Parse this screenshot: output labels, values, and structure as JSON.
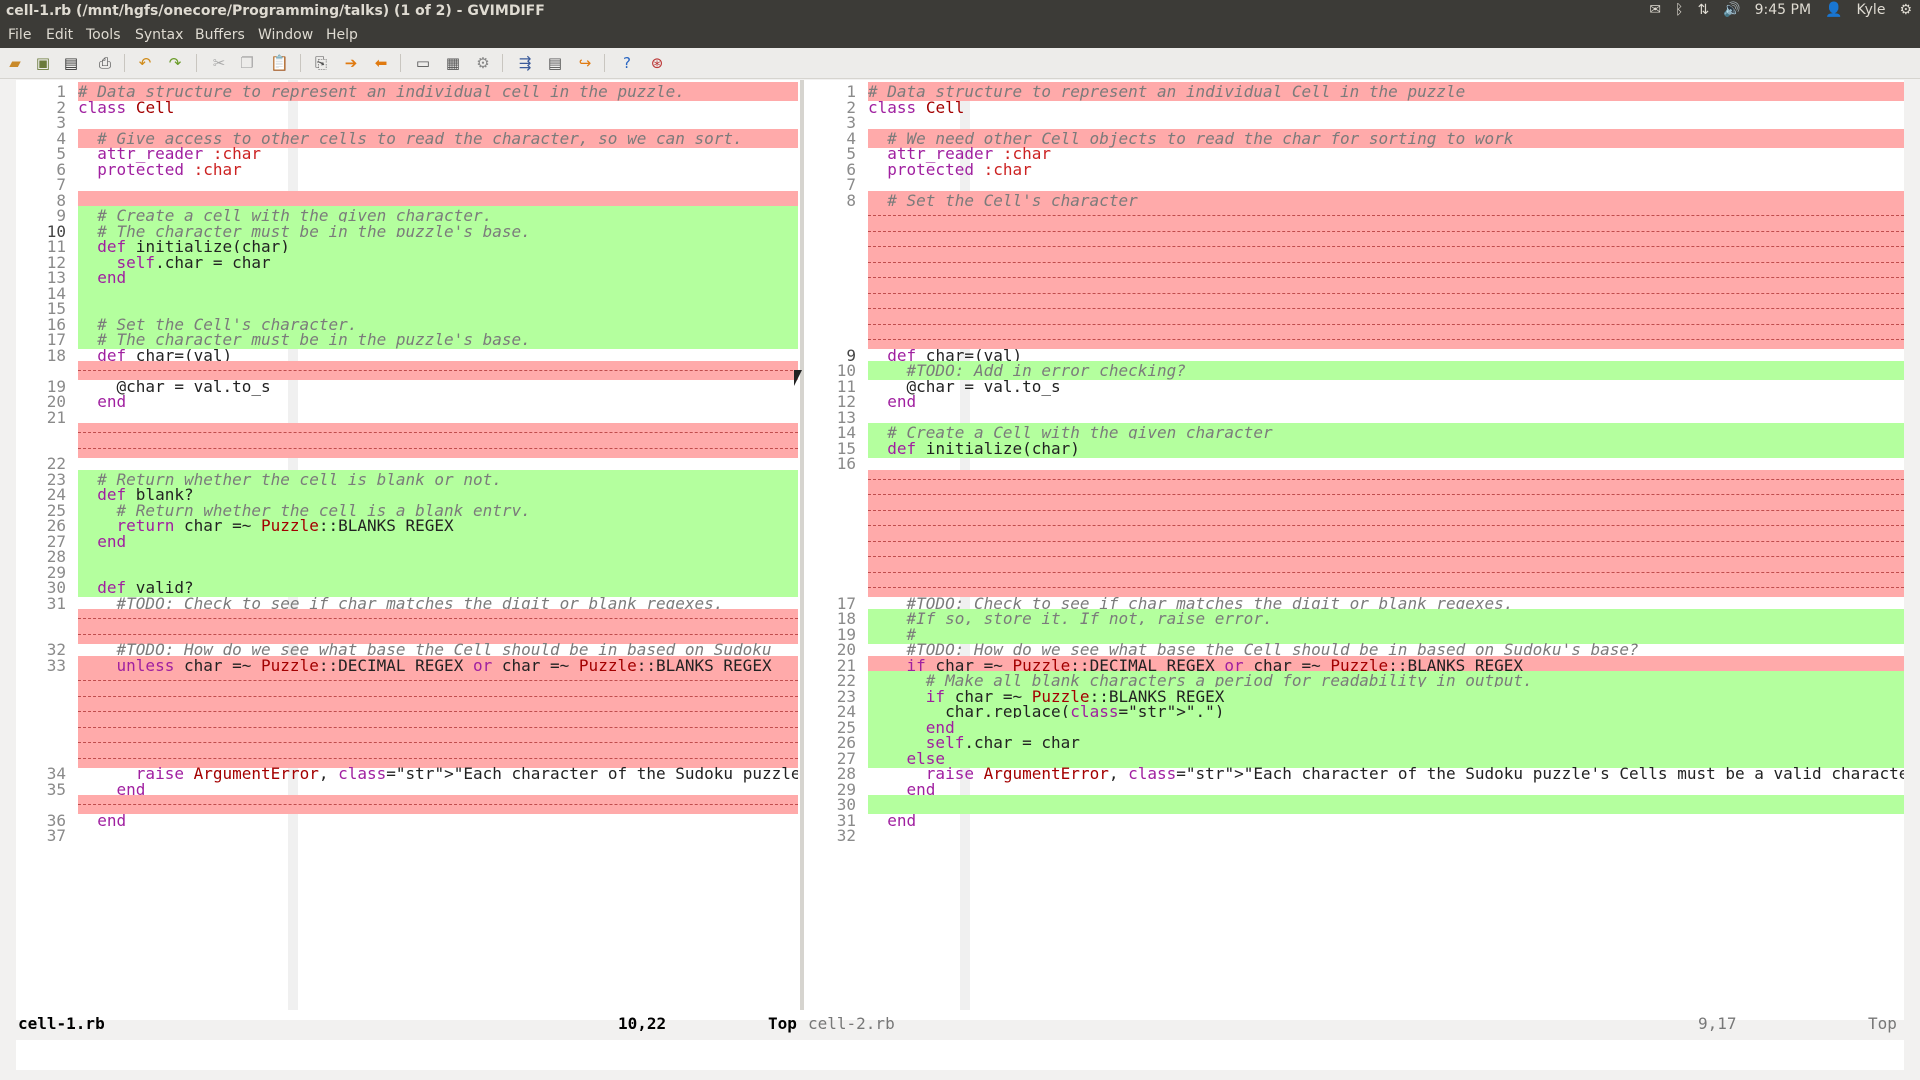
{
  "window": {
    "title": "cell-1.rb (/mnt/hgfs/onecore/Programming/talks) (1 of 2) - GVIMDIFF"
  },
  "tray": {
    "time": "9:45 PM",
    "user": "Kyle"
  },
  "menu": [
    "File",
    "Edit",
    "Tools",
    "Syntax",
    "Buffers",
    "Window",
    "Help"
  ],
  "toolbar_icons": [
    "open-icon",
    "save-icon",
    "save-all-icon",
    "print-icon",
    "undo-icon",
    "redo-icon",
    "cut-icon",
    "copy-icon",
    "paste-icon",
    "find-replace-icon",
    "find-next-icon",
    "find-prev-icon",
    "load-session-icon",
    "save-session-icon",
    "run-script-icon",
    "make-icon",
    "shell-icon",
    "ctags-icon",
    "help-icon",
    "find-help-icon"
  ],
  "colors": {
    "added": "#b4ff9e",
    "changed": "#ffaaaa",
    "deleted_filler": "#ffaaaa"
  },
  "left_pane": {
    "filename": "cell-1.rb",
    "cursor_position": "10,22",
    "scroll": "Top",
    "lines": [
      {
        "n": "1",
        "bg": "change",
        "text": "# Data structure to represent an individual cell in the puzzle."
      },
      {
        "n": "2",
        "bg": "",
        "text": "class Cell"
      },
      {
        "n": "3",
        "bg": "",
        "text": ""
      },
      {
        "n": "4",
        "bg": "change",
        "text": "  # Give access to other cells to read the character, so we can sort."
      },
      {
        "n": "5",
        "bg": "",
        "text": "  attr_reader :char"
      },
      {
        "n": "6",
        "bg": "",
        "text": "  protected :char"
      },
      {
        "n": "7",
        "bg": "",
        "text": ""
      },
      {
        "n": "8",
        "bg": "change",
        "text": ""
      },
      {
        "n": "9",
        "bg": "add",
        "text": "  # Create a cell with the given character."
      },
      {
        "n": "10",
        "bg": "add",
        "text": "  # The character must be in the puzzle's base.",
        "cur": true
      },
      {
        "n": "11",
        "bg": "add",
        "text": "  def initialize(char)"
      },
      {
        "n": "12",
        "bg": "add",
        "text": "    self.char = char"
      },
      {
        "n": "13",
        "bg": "add",
        "text": "  end"
      },
      {
        "n": "14",
        "bg": "add",
        "text": ""
      },
      {
        "n": "15",
        "bg": "add",
        "text": ""
      },
      {
        "n": "16",
        "bg": "add",
        "text": "  # Set the Cell's character."
      },
      {
        "n": "17",
        "bg": "add",
        "text": "  # The character must be in the puzzle's base."
      },
      {
        "n": "18",
        "bg": "",
        "text": "  def char=(val)"
      },
      {
        "n": "",
        "bg": "filler",
        "text": ""
      },
      {
        "n": "19",
        "bg": "",
        "text": "    @char = val.to_s"
      },
      {
        "n": "20",
        "bg": "",
        "text": "  end"
      },
      {
        "n": "21",
        "bg": "",
        "text": ""
      },
      {
        "n": "",
        "bg": "filler",
        "text": ""
      },
      {
        "n": "",
        "bg": "filler",
        "text": ""
      },
      {
        "n": "22",
        "bg": "",
        "text": ""
      },
      {
        "n": "23",
        "bg": "add",
        "text": "  # Return whether the cell is blank or not."
      },
      {
        "n": "24",
        "bg": "add",
        "text": "  def blank?"
      },
      {
        "n": "25",
        "bg": "add",
        "text": "    # Return whether the cell is a blank entry."
      },
      {
        "n": "26",
        "bg": "add",
        "text": "    return char =~ Puzzle::BLANKS_REGEX"
      },
      {
        "n": "27",
        "bg": "add",
        "text": "  end"
      },
      {
        "n": "28",
        "bg": "add",
        "text": ""
      },
      {
        "n": "29",
        "bg": "add",
        "text": ""
      },
      {
        "n": "30",
        "bg": "add",
        "text": "  def valid?"
      },
      {
        "n": "31",
        "bg": "",
        "text": "    #TODO: Check to see if char matches the digit or blank regexes."
      },
      {
        "n": "",
        "bg": "filler",
        "text": ""
      },
      {
        "n": "",
        "bg": "filler",
        "text": ""
      },
      {
        "n": "32",
        "bg": "",
        "text": "    #TODO: How do we see what base the Cell should be in based on Sudoku"
      },
      {
        "n": "33",
        "bg": "change",
        "text": "    unless char =~ Puzzle::DECIMAL_REGEX or char =~ Puzzle::BLANKS_REGEX"
      },
      {
        "n": "",
        "bg": "filler",
        "text": ""
      },
      {
        "n": "",
        "bg": "filler",
        "text": ""
      },
      {
        "n": "",
        "bg": "filler",
        "text": ""
      },
      {
        "n": "",
        "bg": "filler",
        "text": ""
      },
      {
        "n": "",
        "bg": "filler",
        "text": ""
      },
      {
        "n": "",
        "bg": "filler",
        "text": ""
      },
      {
        "n": "34",
        "bg": "",
        "text": "      raise ArgumentError, \"Each character of the Sudoku puzzle's Cells"
      },
      {
        "n": "35",
        "bg": "",
        "text": "    end"
      },
      {
        "n": "",
        "bg": "filler",
        "text": ""
      },
      {
        "n": "36",
        "bg": "",
        "text": "  end"
      },
      {
        "n": "37",
        "bg": "",
        "text": ""
      }
    ]
  },
  "right_pane": {
    "filename": "cell-2.rb",
    "cursor_position": "9,17",
    "scroll": "Top",
    "lines": [
      {
        "n": "1",
        "bg": "change",
        "text": "# Data structure to represent an individual Cell in the puzzle"
      },
      {
        "n": "2",
        "bg": "",
        "text": "class Cell"
      },
      {
        "n": "3",
        "bg": "",
        "text": ""
      },
      {
        "n": "4",
        "bg": "change",
        "text": "  # We need other Cell objects to read the char for sorting to work"
      },
      {
        "n": "5",
        "bg": "",
        "text": "  attr_reader :char"
      },
      {
        "n": "6",
        "bg": "",
        "text": "  protected :char"
      },
      {
        "n": "7",
        "bg": "",
        "text": ""
      },
      {
        "n": "8",
        "bg": "change",
        "text": "  # Set the Cell's character"
      },
      {
        "n": "",
        "bg": "filler",
        "text": ""
      },
      {
        "n": "",
        "bg": "filler",
        "text": ""
      },
      {
        "n": "",
        "bg": "filler",
        "text": ""
      },
      {
        "n": "",
        "bg": "filler",
        "text": ""
      },
      {
        "n": "",
        "bg": "filler",
        "text": ""
      },
      {
        "n": "",
        "bg": "filler",
        "text": ""
      },
      {
        "n": "",
        "bg": "filler",
        "text": ""
      },
      {
        "n": "",
        "bg": "filler",
        "text": ""
      },
      {
        "n": "",
        "bg": "filler",
        "text": ""
      },
      {
        "n": "9",
        "bg": "",
        "text": "  def char=(val)",
        "cur": true
      },
      {
        "n": "10",
        "bg": "add",
        "text": "    #TODO: Add in error checking?"
      },
      {
        "n": "11",
        "bg": "",
        "text": "    @char = val.to_s"
      },
      {
        "n": "12",
        "bg": "",
        "text": "  end"
      },
      {
        "n": "13",
        "bg": "",
        "text": ""
      },
      {
        "n": "14",
        "bg": "add",
        "text": "  # Create a Cell with the given character"
      },
      {
        "n": "15",
        "bg": "add",
        "text": "  def initialize(char)"
      },
      {
        "n": "16",
        "bg": "",
        "text": ""
      },
      {
        "n": "",
        "bg": "filler",
        "text": ""
      },
      {
        "n": "",
        "bg": "filler",
        "text": ""
      },
      {
        "n": "",
        "bg": "filler",
        "text": ""
      },
      {
        "n": "",
        "bg": "filler",
        "text": ""
      },
      {
        "n": "",
        "bg": "filler",
        "text": ""
      },
      {
        "n": "",
        "bg": "filler",
        "text": ""
      },
      {
        "n": "",
        "bg": "filler",
        "text": ""
      },
      {
        "n": "",
        "bg": "filler",
        "text": ""
      },
      {
        "n": "17",
        "bg": "",
        "text": "    #TODO: Check to see if char matches the digit or blank regexes."
      },
      {
        "n": "18",
        "bg": "add",
        "text": "    #If so, store it. If not, raise error."
      },
      {
        "n": "19",
        "bg": "add",
        "text": "    #"
      },
      {
        "n": "20",
        "bg": "",
        "text": "    #TODO: How do we see what base the Cell should be in based on Sudoku's base?"
      },
      {
        "n": "21",
        "bg": "change",
        "text": "    if char =~ Puzzle::DECIMAL_REGEX or char =~ Puzzle::BLANKS_REGEX"
      },
      {
        "n": "22",
        "bg": "add",
        "text": "      # Make all blank characters a period for readability in output."
      },
      {
        "n": "23",
        "bg": "add",
        "text": "      if char =~ Puzzle::BLANKS_REGEX"
      },
      {
        "n": "24",
        "bg": "add",
        "text": "        char.replace(\".\")"
      },
      {
        "n": "25",
        "bg": "add",
        "text": "      end"
      },
      {
        "n": "26",
        "bg": "add",
        "text": "      self.char = char"
      },
      {
        "n": "27",
        "bg": "add",
        "text": "    else"
      },
      {
        "n": "28",
        "bg": "",
        "text": "      raise ArgumentError, \"Each character of the Sudoku puzzle's Cells must be a valid character or bl"
      },
      {
        "n": "29",
        "bg": "",
        "text": "    end"
      },
      {
        "n": "30",
        "bg": "add",
        "text": ""
      },
      {
        "n": "31",
        "bg": "",
        "text": "  end"
      },
      {
        "n": "32",
        "bg": "",
        "text": ""
      }
    ]
  }
}
